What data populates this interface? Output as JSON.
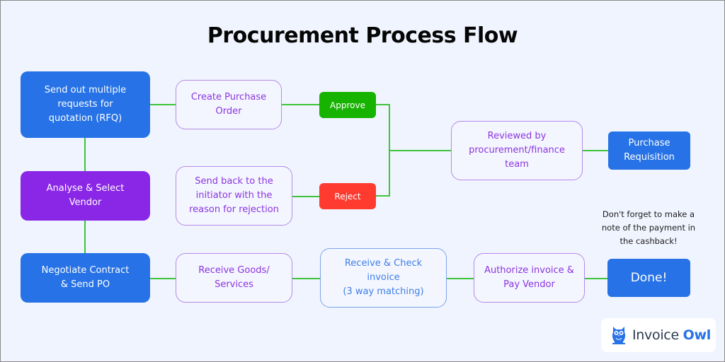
{
  "title": "Procurement Process Flow",
  "colors": {
    "background": "#f0f4fe",
    "primary_blue": "#2672e6",
    "primary_purple": "#8a27e6",
    "approve_green": "#16b300",
    "reject_red": "#ff3b30",
    "connector_green": "#3ec43a",
    "outline_purple": "#b58ae8",
    "outline_blue": "#7aa5ea"
  },
  "nodes": {
    "rfq": "Send out multiple\nrequests for\nquotation (RFQ)",
    "analyse_vendor": "Analyse & Select\nVendor",
    "negotiate": "Negotiate Contract\n& Send PO",
    "create_po": "Create Purchase\nOrder",
    "send_back": "Send back to the\ninitiator with the\nreason for rejection",
    "receive_goods": "Receive Goods/\nServices",
    "approve": "Approve",
    "reject": "Reject",
    "reviewed": "Reviewed by\nprocurement/finance\nteam",
    "purchase_requisition": "Purchase\nRequisition",
    "receive_check": "Receive & Check\ninvoice\n(3 way matching)",
    "authorize": "Authorize invoice &\nPay Vendor",
    "done": "Done!"
  },
  "note": "Don't forget to make a\nnote of the payment in\nthe cashback!",
  "logo": {
    "icon": "owl-icon",
    "text_primary": "Invoice",
    "text_accent": "Owl"
  }
}
